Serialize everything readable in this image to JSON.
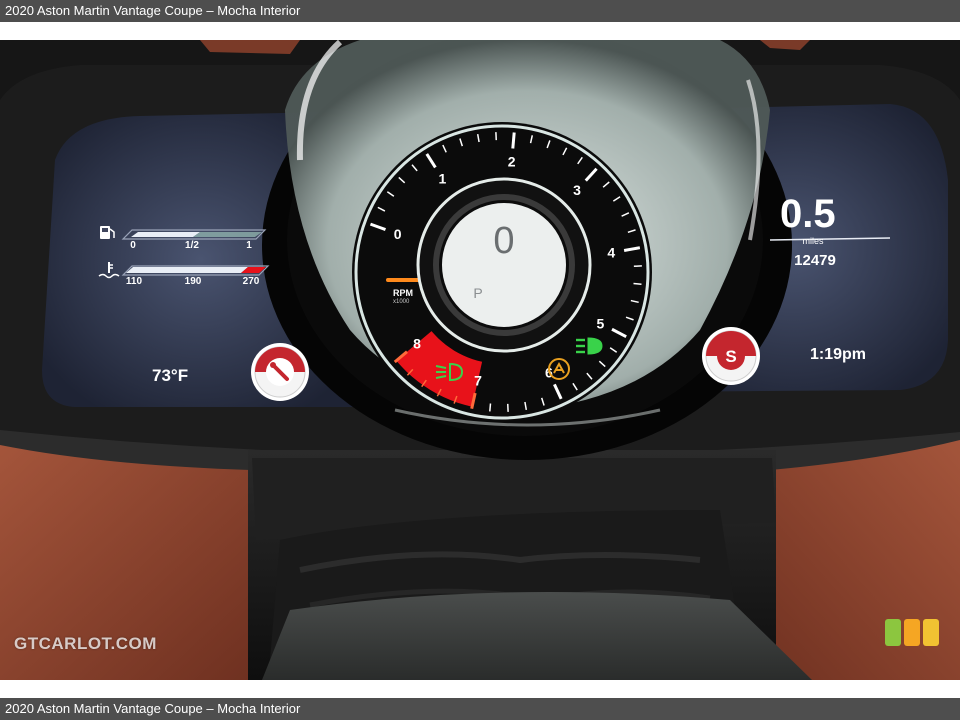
{
  "caption": {
    "top": "2020 Aston Martin Vantage Coupe – Mocha Interior",
    "bottom": "2020 Aston Martin Vantage Coupe – Mocha Interior"
  },
  "watermark": "GTCARLOT.COM",
  "cluster": {
    "fuel": {
      "icon": "fuel-pump-icon",
      "labels": [
        "0",
        "1/2",
        "1"
      ]
    },
    "coolant": {
      "icon": "coolant-temperature-icon",
      "labels": [
        "110",
        "190",
        "270"
      ]
    },
    "outside_temp": "73°F",
    "left_dial_icon": "wiper-lever-icon",
    "trip": {
      "value": "0.5",
      "unit": "miles",
      "odometer": "12479"
    },
    "right_dial_letter": "S",
    "clock": "1:19pm",
    "tachometer": {
      "labels": [
        "0",
        "1",
        "2",
        "3",
        "4",
        "5",
        "6",
        "7",
        "8"
      ],
      "unit_line1": "RPM",
      "unit_line2": "x1000",
      "speed": "0",
      "gear": "P",
      "redline_start": 7
    },
    "indicators": {
      "left": "low-beam-headlight-icon",
      "center": "traction-control-icon",
      "right": "high-beam-headlight-icon"
    }
  },
  "colors": {
    "caption_bar": "#4e4e4e",
    "leather": "#8c4430",
    "redline": "#e8121a",
    "indicator_green": "#39d24a",
    "indicator_amber": "#e8a020",
    "brand_green": "#8cc63f",
    "brand_orange": "#f5a623",
    "brand_yellow": "#f1c232"
  }
}
